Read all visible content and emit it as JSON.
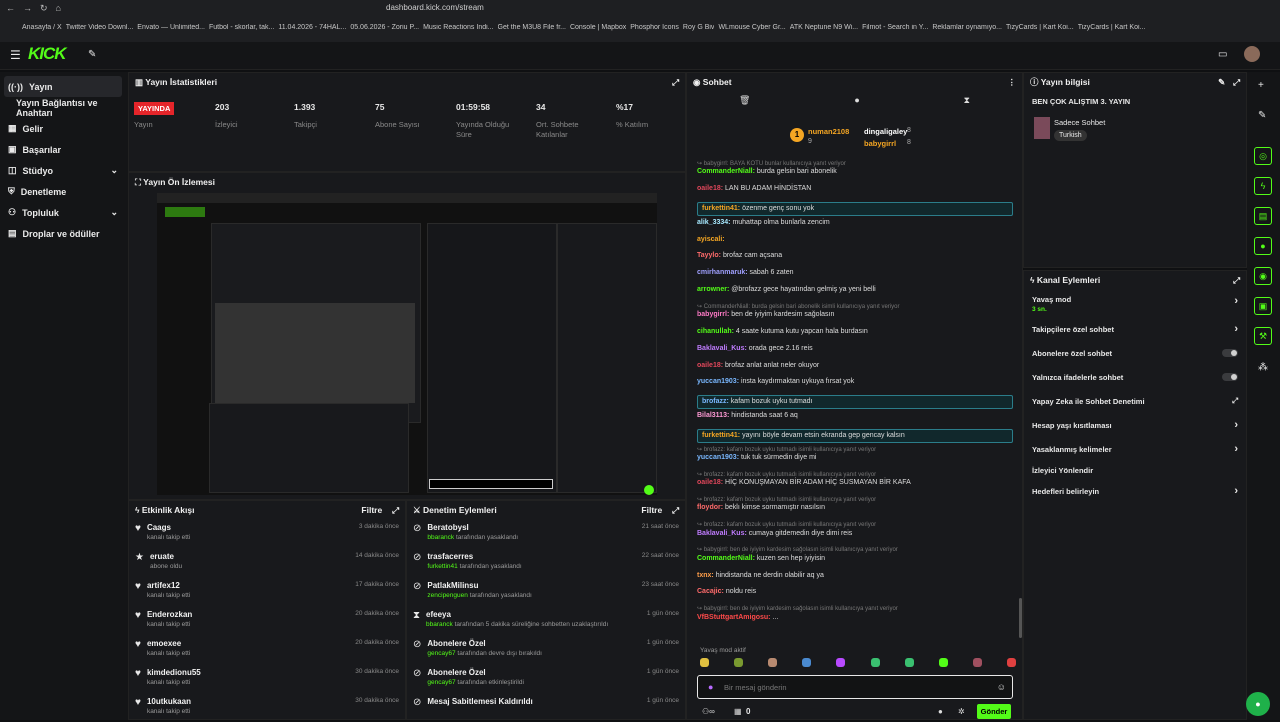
{
  "browser": {
    "url": "dashboard.kick.com/stream",
    "bookmarks": [
      "Anasayfa / X",
      "Twitter Video Downl...",
      "Envato — Unlimited...",
      "Futbol - skorlar, tak...",
      "11.04.2026 - 74HAL...",
      "05.06.2026 - Zoriu P...",
      "Music Reactions Indi...",
      "Get the M3U8 File fr...",
      "Console | Mapbox",
      "Phosphor Icons",
      "Roy G Biv",
      "WLmouse Cyber Gr...",
      "ATK Neptune N9 Wi...",
      "Filmot - Search in Y...",
      "Reklamlar oynamıyo...",
      "TizyCards | Kart Koi...",
      "TizyCards | Kart Koi..."
    ]
  },
  "sidebar": {
    "items": [
      {
        "label": "Yayın"
      },
      {
        "label": "Yayın Bağlantısı ve Anahtarı"
      },
      {
        "label": "Gelir"
      },
      {
        "label": "Başarılar"
      },
      {
        "label": "Stüdyo"
      },
      {
        "label": "Denetleme"
      },
      {
        "label": "Topluluk"
      },
      {
        "label": "Droplar ve ödüller"
      }
    ]
  },
  "stats": {
    "title": "Yayın İstatistikleri",
    "live_badge": "YAYINDA",
    "items": [
      {
        "value": "",
        "label": "Yayın"
      },
      {
        "value": "203",
        "label": "İzleyici"
      },
      {
        "value": "1.393",
        "label": "Takipçi"
      },
      {
        "value": "75",
        "label": "Abone Sayısı"
      },
      {
        "value": "01:59:58",
        "label": "Yayında Olduğu Süre"
      },
      {
        "value": "34",
        "label": "Ort. Sohbete Katılanlar"
      },
      {
        "value": "%17",
        "label": "% Katılım"
      }
    ]
  },
  "preview": {
    "title": "Yayın Ön İzlemesi"
  },
  "activity": {
    "title": "Etkinlik Akışı",
    "filter": "Filtre",
    "rows": [
      {
        "name": "Caags",
        "sub": "kanalı takip etti",
        "time": "3 dakika önce"
      },
      {
        "name": "eruate",
        "sub": "abone oldu",
        "time": "14 dakika önce"
      },
      {
        "name": "artifex12",
        "sub": "kanalı takip etti",
        "time": "17 dakika önce"
      },
      {
        "name": "Enderozkan",
        "sub": "kanalı takip etti",
        "time": "20 dakika önce"
      },
      {
        "name": "emoexee",
        "sub": "kanalı takip etti",
        "time": "20 dakika önce"
      },
      {
        "name": "kimdedionu55",
        "sub": "kanalı takip etti",
        "time": "30 dakika önce"
      },
      {
        "name": "10utkukaan",
        "sub": "kanalı takip etti",
        "time": "30 dakika önce"
      }
    ]
  },
  "moderation": {
    "title": "Denetim Eylemleri",
    "filter": "Filtre",
    "rows": [
      {
        "name": "Beratobysl",
        "actor": "bbaranck",
        "sub": "tarafından yasaklandı",
        "time": "21 saat önce"
      },
      {
        "name": "trasfacerres",
        "actor": "furkettin41",
        "sub": "tarafından yasaklandı",
        "time": "22 saat önce"
      },
      {
        "name": "PatlakMilinsu",
        "actor": "zencipenguen",
        "sub": "tarafından yasaklandı",
        "time": "23 saat önce"
      },
      {
        "name": "efeeya",
        "actor": "bbaranck",
        "sub": "tarafından 5 dakika süreliğine sohbetten uzaklaştırıldı",
        "time": "1 gün önce"
      },
      {
        "name": "Abonelere Özel",
        "actor": "gencay67",
        "sub": "tarafından devre dışı bırakıldı",
        "time": "1 gün önce"
      },
      {
        "name": "Abonelere Özel",
        "actor": "gencay67",
        "sub": "tarafından etkinleştirildi",
        "time": "1 gün önce"
      },
      {
        "name": "Mesaj Sabitlemesi Kaldırıldı",
        "actor": "",
        "sub": "",
        "time": "1 gün önce"
      }
    ]
  },
  "chat": {
    "title": "Sohbet",
    "top": {
      "u1": "numan2108",
      "c1": "9",
      "u2": "dingaligaley",
      "c2": "8",
      "u3": "babygirrl",
      "c3": "8"
    },
    "messages": [
      {
        "user": "",
        "text": "babygirrl: BAYA KOTU bunlar kullanıcıya yanıt veriyor",
        "color": "#777",
        "reply": true
      },
      {
        "user": "CommanderNiall:",
        "text": "burda gelsin bari abonelik",
        "color": "#53fc18"
      },
      {
        "user": "oaile18:",
        "text": "LAN BU ADAM HİNDİSTAN",
        "color": "#e0475b"
      },
      {
        "user": "furkettin41:",
        "text": "özenme genç sonu yok",
        "color": "#f5a623",
        "hl": true
      },
      {
        "user": "alik_3334:",
        "text": "muhattap olma bunlarla zencim",
        "color": "#a7e9ff"
      },
      {
        "user": "ayiscali:",
        "text": "",
        "color": "#f5a623"
      },
      {
        "user": "Tayylo:",
        "text": "brofaz cam açsana",
        "color": "#ff6b6b"
      },
      {
        "user": "cmirhanmaruk:",
        "text": "sabah 6 zaten",
        "color": "#a0a0ff"
      },
      {
        "user": "arrowner:",
        "text": "@brofazz gece hayatından gelmiş ya yeni belli",
        "color": "#53fc18"
      },
      {
        "user": "",
        "text": "CommanderNiall: burda gelsin bari abonelik isimli kullanıcıya yanıt veriyor",
        "color": "#777",
        "reply": true
      },
      {
        "user": "babygirrl:",
        "text": "ben de iyiyim kardesim sağolasın",
        "color": "#ff7ac6"
      },
      {
        "user": "cihanullah:",
        "text": "4 saate kutuma kutu yapcan hala burdasın",
        "color": "#53fc18"
      },
      {
        "user": "Baklavali_Kus:",
        "text": "orada gece 2.16 reis",
        "color": "#c07cff"
      },
      {
        "user": "oaile18:",
        "text": "brofaz anlat anlat neler okuyor",
        "color": "#e0475b"
      },
      {
        "user": "yuccan1903:",
        "text": "insta kaydırmaktan uykuya fırsat yok",
        "color": "#7ab8ff"
      },
      {
        "user": "brofazz:",
        "text": "kafam bozuk uyku tutmadı",
        "color": "#7ab8ff",
        "hl": true
      },
      {
        "user": "Bilal3113:",
        "text": "hindistanda saat 6 aq",
        "color": "#ff9ad5"
      },
      {
        "user": "furkettin41:",
        "text": "yayını böyle devam etsin ekranda gep gencay kalsın",
        "color": "#f5a623",
        "hl": true
      },
      {
        "user": "",
        "text": "brofazz: kafam bozuk uyku tutmadı isimli kullanıcıya yanıt veriyor",
        "color": "#777",
        "reply": true
      },
      {
        "user": "yuccan1903:",
        "text": "tuk tuk sürmedin diye mi",
        "color": "#7ab8ff"
      },
      {
        "user": "",
        "text": "brofazz: kafam bozuk uyku tutmadı isimli kullanıcıya yanıt veriyor",
        "color": "#777",
        "reply": true
      },
      {
        "user": "oaile18:",
        "text": "HİÇ KONUŞMAYAN BİR ADAM HİÇ SUSMAYAN BİR KAFA",
        "color": "#e0475b"
      },
      {
        "user": "",
        "text": "brofazz: kafam bozuk uyku tutmadı isimli kullanıcıya yanıt veriyor",
        "color": "#777",
        "reply": true
      },
      {
        "user": "floydor:",
        "text": "beklı kimse sormamıştır nasılsın",
        "color": "#ff6b6b"
      },
      {
        "user": "",
        "text": "brofazz: kafam bozuk uyku tutmadı isimli kullanıcıya yanıt veriyor",
        "color": "#777",
        "reply": true
      },
      {
        "user": "Baklavali_Kus:",
        "text": "cumaya gitdemedin diye dimi reis",
        "color": "#c07cff"
      },
      {
        "user": "",
        "text": "babygirrl: ben de iyiyim kardesim sağolasın isimli kullanıcıya yanıt veriyor",
        "color": "#777",
        "reply": true
      },
      {
        "user": "CommanderNiall:",
        "text": "kuzen sen hep iyiyisin",
        "color": "#53fc18"
      },
      {
        "user": "txnx:",
        "text": "hindistanda ne derdin olabilir aq ya",
        "color": "#ff9e4a"
      },
      {
        "user": "Cacajic:",
        "text": "noldu reis",
        "color": "#ff6b6b"
      },
      {
        "user": "",
        "text": "babygirrl: ben de iyiyim kardesim sağolasın isimli kullanıcıya yanıt veriyor",
        "color": "#777",
        "reply": true
      },
      {
        "user": "VfBStuttgartAmigosu:",
        "text": "...",
        "color": "#ff4a4a"
      }
    ],
    "slow_mode": "Yavaş mod aktif",
    "placeholder": "Bir mesaj gönderin",
    "send": "Gönder",
    "count": "0"
  },
  "info": {
    "title": "Yayın bilgisi",
    "stream_title": "BEN ÇOK ALIŞTIM 3. YAYIN",
    "category": "Sadece Sohbet",
    "tag": "Turkish"
  },
  "channel_actions": {
    "title": "Kanal Eylemleri",
    "slow_mode_label": "Yavaş mod",
    "slow_mode_value": "3 sn.",
    "followers_only": "Takipçilere özel sohbet",
    "subscribers_only": "Abonelere özel sohbet",
    "emotes_only": "Yalnızca ifadelerle sohbet",
    "ai_moderation": "Yapay Zeka ile Sohbet Denetimi",
    "account_age": "Hesap yaşı kısıtlaması",
    "banned_words": "Yasaklanmış kelimeler",
    "viewer_redirect": "İzleyici Yönlendir",
    "goals": "Hedefleri belirleyin"
  },
  "colors": {
    "accent": "#53fc18",
    "live": "#e5252a"
  }
}
